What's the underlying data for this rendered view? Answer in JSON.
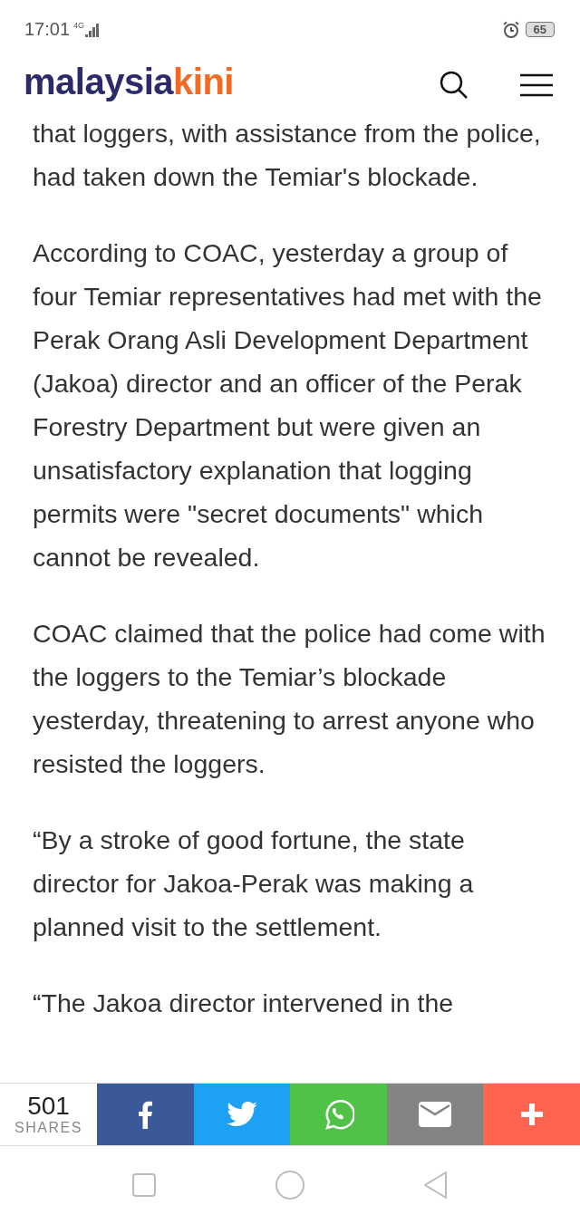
{
  "status_bar": {
    "time": "17:01",
    "network": "4G",
    "battery": "65"
  },
  "header": {
    "logo": {
      "primary": "malaysia",
      "accent": "kini"
    }
  },
  "article": {
    "paragraphs": [
      "that loggers, with assistance from the police, had taken down the Temiar's blockade.",
      "According to COAC, yesterday a group of four Temiar representatives had met with the Perak Orang Asli Development Department (Jakoa) director and an officer of the Perak Forestry Department but were given an unsatisfactory explanation that logging permits were \"secret documents\" which cannot be revealed.",
      "COAC claimed that the police had come with the loggers to the Temiar’s blockade yesterday, threatening to arrest anyone who resisted the loggers.",
      "“By a stroke of good fortune, the state director for Jakoa-Perak was making a planned visit to the settlement.",
      "“The Jakoa director intervened in the"
    ]
  },
  "share_bar": {
    "count": "501",
    "label": "SHARES",
    "buttons": [
      {
        "kind": "facebook",
        "color": "#3b5998"
      },
      {
        "kind": "twitter",
        "color": "#1da1f2"
      },
      {
        "kind": "whatsapp",
        "color": "#4fc247"
      },
      {
        "kind": "email",
        "color": "#848484"
      },
      {
        "kind": "more",
        "color": "#fe6450"
      }
    ]
  }
}
